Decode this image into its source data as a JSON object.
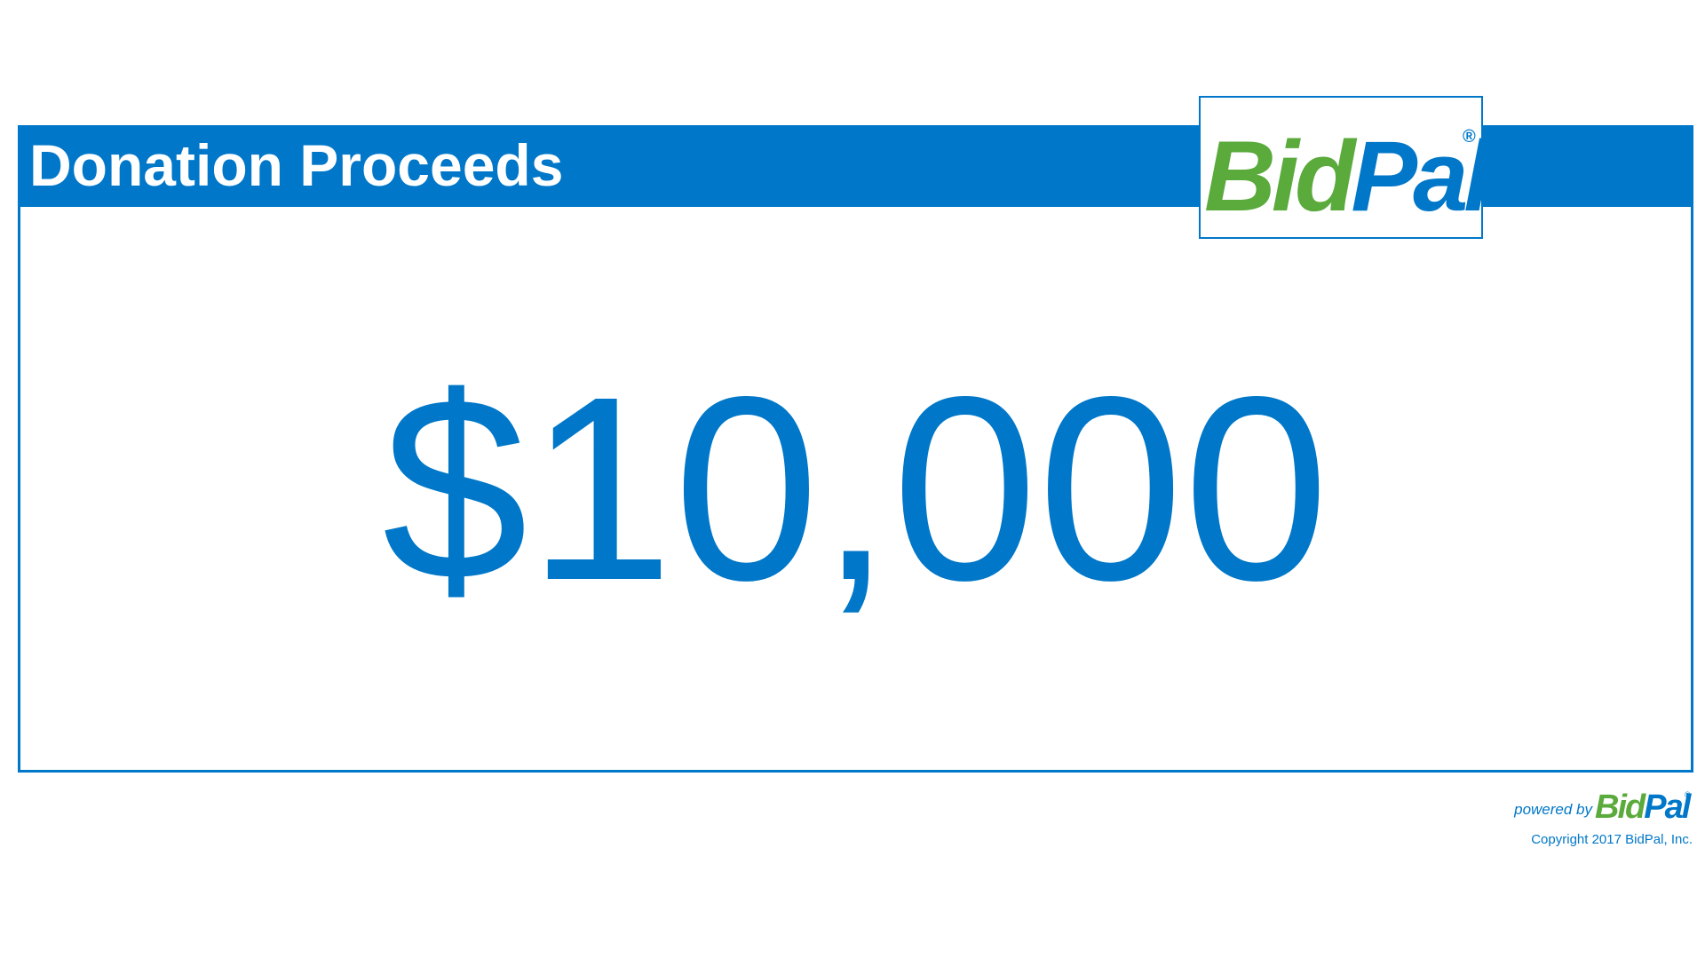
{
  "header": {
    "title": "Donation Proceeds"
  },
  "logo": {
    "part1": "Bid",
    "part2": "Pal",
    "registered": "®"
  },
  "main": {
    "amount": "$10,000"
  },
  "footer": {
    "powered_by": "powered by",
    "logo_part1": "Bid",
    "logo_part2": "Pal",
    "logo_registered": "®",
    "copyright": "Copyright 2017 BidPal, Inc."
  },
  "colors": {
    "brand_blue": "#0077c8",
    "brand_green": "#5aaa3c",
    "background": "#ffffff"
  }
}
